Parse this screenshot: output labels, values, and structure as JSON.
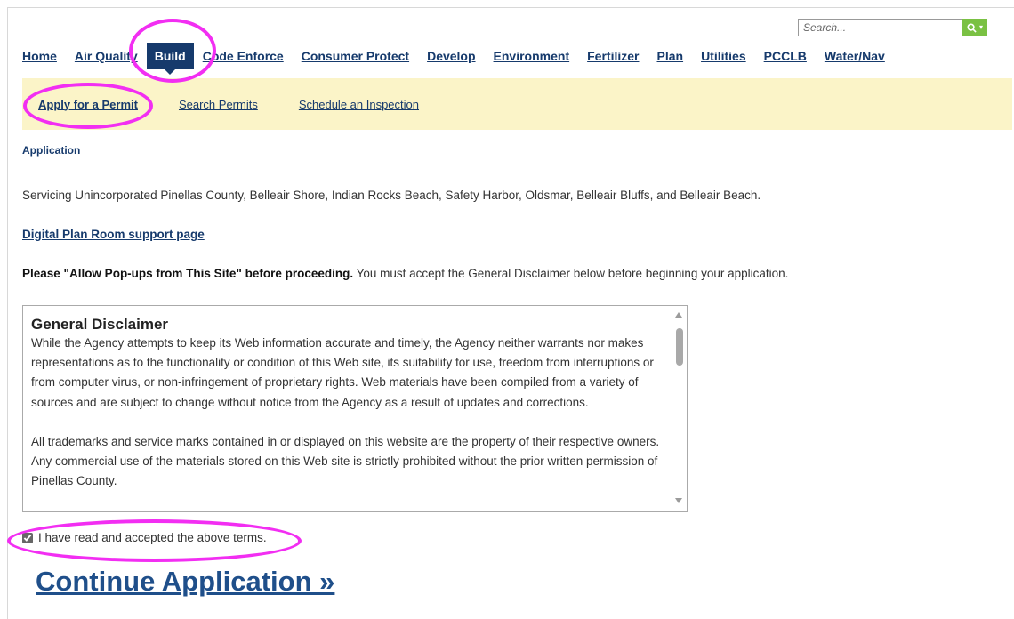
{
  "search": {
    "placeholder": "Search..."
  },
  "nav": {
    "items": [
      {
        "label": "Home",
        "key": "home"
      },
      {
        "label": "Air Quality",
        "key": "air-quality"
      },
      {
        "label": "Build",
        "key": "build",
        "active": true
      },
      {
        "label": "Code Enforce",
        "key": "code-enforce"
      },
      {
        "label": "Consumer Protect",
        "key": "consumer-protect"
      },
      {
        "label": "Develop",
        "key": "develop"
      },
      {
        "label": "Environment",
        "key": "environment"
      },
      {
        "label": "Fertilizer",
        "key": "fertilizer"
      },
      {
        "label": "Plan",
        "key": "plan"
      },
      {
        "label": "Utilities",
        "key": "utilities"
      },
      {
        "label": "PCCLB",
        "key": "pcclb"
      },
      {
        "label": "Water/Nav",
        "key": "water-nav"
      }
    ]
  },
  "subnav": {
    "items": [
      {
        "label": "Apply for a Permit",
        "key": "apply-permit",
        "current": true
      },
      {
        "label": "Search Permits",
        "key": "search-permits"
      },
      {
        "label": "Schedule an Inspection",
        "key": "schedule-inspection"
      }
    ]
  },
  "main": {
    "section_label": "Application",
    "servicing_text": "Servicing Unincorporated Pinellas County, Belleair Shore, Indian Rocks Beach, Safety Harbor, Oldsmar, Belleair Bluffs, and Belleair Beach.",
    "plan_room_link": "Digital Plan Room support page",
    "popups_bold": "Please \"Allow Pop-ups from This Site\" before proceeding.",
    "popups_rest": " You must accept the General Disclaimer below before beginning your application."
  },
  "disclaimer": {
    "title": "General Disclaimer",
    "paragraphs": [
      "While the Agency attempts to keep its Web information accurate and timely, the Agency neither warrants nor makes representations as to the functionality or condition of this Web site, its suitability for use, freedom from interruptions or from computer virus, or non-infringement of proprietary rights. Web materials have been compiled from a variety of sources and are subject to change without notice from the Agency as a result of updates and corrections.",
      "All trademarks and service marks contained in or displayed on this website are the property of their respective owners. Any commercial use of the materials stored on this Web site is strictly prohibited without the prior written permission of Pinellas County."
    ]
  },
  "accept": {
    "label": "I have read and accepted the above terms.",
    "checked": true
  },
  "continue_label": "Continue Application »",
  "colors": {
    "nav_text": "#163a6c",
    "subnav_bg": "#fbf4c8",
    "search_button": "#7ac143",
    "annotation": "#f22ef2"
  },
  "icons": {
    "search_button": "search-icon",
    "dropdown": "caret-down-icon"
  }
}
